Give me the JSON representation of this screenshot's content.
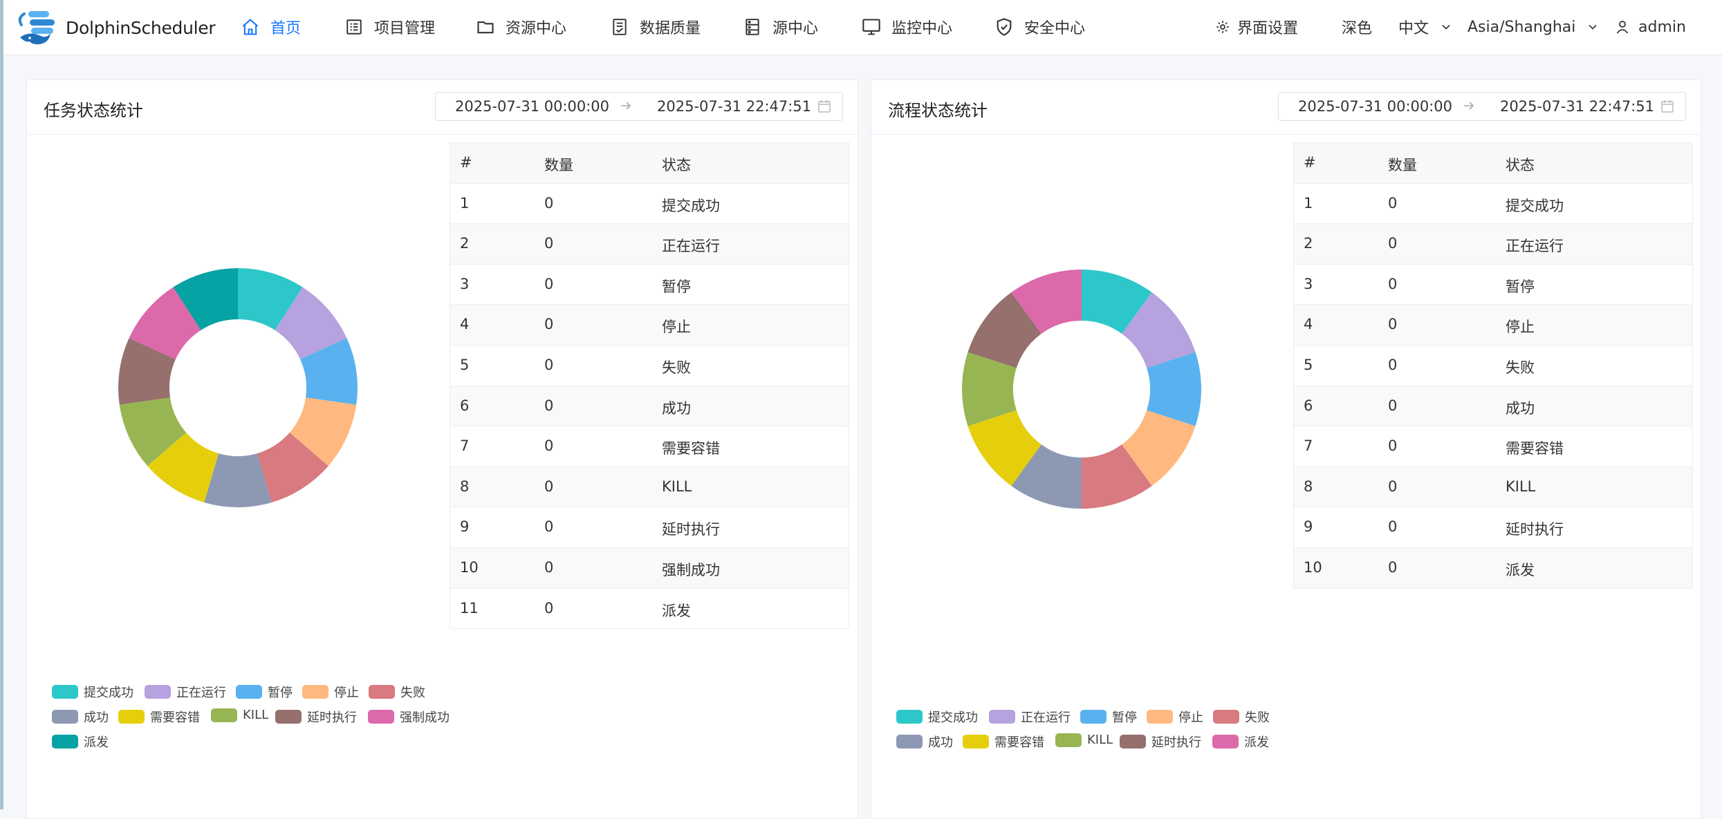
{
  "app": {
    "brand": "DolphinScheduler",
    "nav": [
      {
        "label": "首页",
        "icon": "home-icon",
        "active": true
      },
      {
        "label": "项目管理",
        "icon": "project-list-icon",
        "active": false
      },
      {
        "label": "资源中心",
        "icon": "folder-icon",
        "active": false
      },
      {
        "label": "数据质量",
        "icon": "document-check-icon",
        "active": false
      },
      {
        "label": "源中心",
        "icon": "datasource-icon",
        "active": false
      },
      {
        "label": "监控中心",
        "icon": "monitor-icon",
        "active": false
      },
      {
        "label": "安全中心",
        "icon": "shield-icon",
        "active": false
      }
    ],
    "right": {
      "settings": "界面设置",
      "theme": "深色",
      "language": "中文",
      "timezone": "Asia/Shanghai",
      "user": "admin"
    }
  },
  "task_panel": {
    "title": "任务状态统计",
    "date_start": "2025-07-31 00:00:00",
    "date_end": "2025-07-31 22:47:51",
    "table": {
      "headers": [
        "#",
        "数量",
        "状态"
      ],
      "rows": [
        [
          "1",
          "0",
          "提交成功"
        ],
        [
          "2",
          "0",
          "正在运行"
        ],
        [
          "3",
          "0",
          "暂停"
        ],
        [
          "4",
          "0",
          "停止"
        ],
        [
          "5",
          "0",
          "失败"
        ],
        [
          "6",
          "0",
          "成功"
        ],
        [
          "7",
          "0",
          "需要容错"
        ],
        [
          "8",
          "0",
          "KILL"
        ],
        [
          "9",
          "0",
          "延时执行"
        ],
        [
          "10",
          "0",
          "强制成功"
        ],
        [
          "11",
          "0",
          "派发"
        ]
      ]
    }
  },
  "process_panel": {
    "title": "流程状态统计",
    "date_start": "2025-07-31 00:00:00",
    "date_end": "2025-07-31 22:47:51",
    "table": {
      "headers": [
        "#",
        "数量",
        "状态"
      ],
      "rows": [
        [
          "1",
          "0",
          "提交成功"
        ],
        [
          "2",
          "0",
          "正在运行"
        ],
        [
          "3",
          "0",
          "暂停"
        ],
        [
          "4",
          "0",
          "停止"
        ],
        [
          "5",
          "0",
          "失败"
        ],
        [
          "6",
          "0",
          "成功"
        ],
        [
          "7",
          "0",
          "需要容错"
        ],
        [
          "8",
          "0",
          "KILL"
        ],
        [
          "9",
          "0",
          "延时执行"
        ],
        [
          "10",
          "0",
          "派发"
        ]
      ]
    }
  },
  "chart_data": [
    {
      "type": "pie",
      "variant": "donut",
      "labels": [
        "提交成功",
        "正在运行",
        "暂停",
        "停止",
        "失败",
        "成功",
        "需要容错",
        "KILL",
        "延时执行",
        "强制成功",
        "派发"
      ],
      "values": [
        0,
        0,
        0,
        0,
        0,
        0,
        0,
        0,
        0,
        0,
        0
      ],
      "colors": [
        "#2ec7c9",
        "#b6a2de",
        "#5ab1ef",
        "#ffb980",
        "#d87a80",
        "#8d98b3",
        "#e5cf0d",
        "#97b552",
        "#95706d",
        "#dc69aa",
        "#07a2a4"
      ],
      "legend_position": "bottom-left"
    },
    {
      "type": "pie",
      "variant": "donut",
      "labels": [
        "提交成功",
        "正在运行",
        "暂停",
        "停止",
        "失败",
        "成功",
        "需要容错",
        "KILL",
        "延时执行",
        "派发"
      ],
      "values": [
        0,
        0,
        0,
        0,
        0,
        0,
        0,
        0,
        0,
        0
      ],
      "colors": [
        "#2ec7c9",
        "#b6a2de",
        "#5ab1ef",
        "#ffb980",
        "#d87a80",
        "#8d98b3",
        "#e5cf0d",
        "#97b552",
        "#95706d",
        "#dc69aa"
      ],
      "legend_position": "bottom-left"
    }
  ]
}
